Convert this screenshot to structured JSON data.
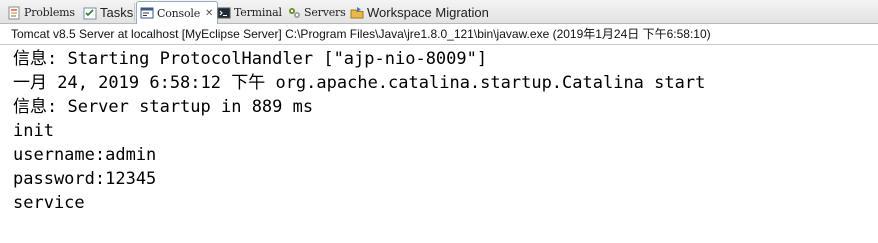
{
  "tabs": [
    {
      "label": "Problems",
      "icon": "problems-icon",
      "active": false
    },
    {
      "label": "Tasks",
      "icon": "tasks-icon",
      "active": false
    },
    {
      "label": "Console",
      "icon": "console-icon",
      "active": true,
      "close_glyph": "✕"
    },
    {
      "label": "Terminal",
      "icon": "terminal-icon",
      "active": false
    },
    {
      "label": "Servers",
      "icon": "servers-icon",
      "active": false
    },
    {
      "label": "Workspace Migration",
      "icon": "workspace-migration-icon",
      "active": false
    }
  ],
  "console": {
    "process_title": "Tomcat v8.5 Server at localhost [MyEclipse Server] C:\\Program Files\\Java\\jre1.8.0_121\\bin\\javaw.exe (2019年1月24日 下午6:58:10)",
    "lines": [
      "信息: Starting ProtocolHandler [\"ajp-nio-8009\"]",
      "一月 24, 2019 6:58:12 下午 org.apache.catalina.startup.Catalina start",
      "信息: Server startup in 889 ms",
      "init",
      "username:admin",
      "password:12345",
      "service"
    ]
  },
  "colors": {
    "console_text": "#000000",
    "background": "#ffffff",
    "tab_active_border": "#9aa9bf"
  }
}
